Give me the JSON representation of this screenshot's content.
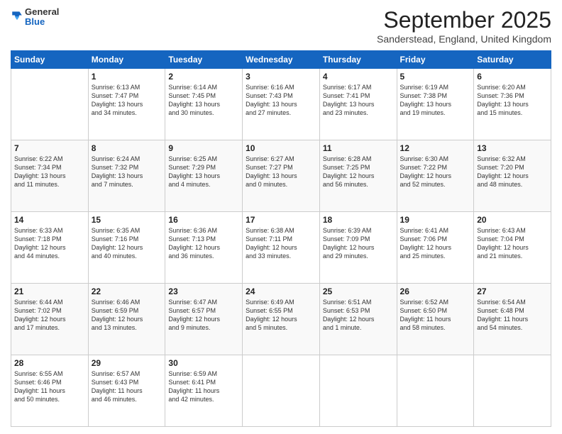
{
  "header": {
    "logo": {
      "general": "General",
      "blue": "Blue"
    },
    "title": "September 2025",
    "subtitle": "Sanderstead, England, United Kingdom"
  },
  "calendar": {
    "days": [
      "Sunday",
      "Monday",
      "Tuesday",
      "Wednesday",
      "Thursday",
      "Friday",
      "Saturday"
    ],
    "weeks": [
      [
        {
          "num": "",
          "info": ""
        },
        {
          "num": "1",
          "info": "Sunrise: 6:13 AM\nSunset: 7:47 PM\nDaylight: 13 hours\nand 34 minutes."
        },
        {
          "num": "2",
          "info": "Sunrise: 6:14 AM\nSunset: 7:45 PM\nDaylight: 13 hours\nand 30 minutes."
        },
        {
          "num": "3",
          "info": "Sunrise: 6:16 AM\nSunset: 7:43 PM\nDaylight: 13 hours\nand 27 minutes."
        },
        {
          "num": "4",
          "info": "Sunrise: 6:17 AM\nSunset: 7:41 PM\nDaylight: 13 hours\nand 23 minutes."
        },
        {
          "num": "5",
          "info": "Sunrise: 6:19 AM\nSunset: 7:38 PM\nDaylight: 13 hours\nand 19 minutes."
        },
        {
          "num": "6",
          "info": "Sunrise: 6:20 AM\nSunset: 7:36 PM\nDaylight: 13 hours\nand 15 minutes."
        }
      ],
      [
        {
          "num": "7",
          "info": "Sunrise: 6:22 AM\nSunset: 7:34 PM\nDaylight: 13 hours\nand 11 minutes."
        },
        {
          "num": "8",
          "info": "Sunrise: 6:24 AM\nSunset: 7:32 PM\nDaylight: 13 hours\nand 7 minutes."
        },
        {
          "num": "9",
          "info": "Sunrise: 6:25 AM\nSunset: 7:29 PM\nDaylight: 13 hours\nand 4 minutes."
        },
        {
          "num": "10",
          "info": "Sunrise: 6:27 AM\nSunset: 7:27 PM\nDaylight: 13 hours\nand 0 minutes."
        },
        {
          "num": "11",
          "info": "Sunrise: 6:28 AM\nSunset: 7:25 PM\nDaylight: 12 hours\nand 56 minutes."
        },
        {
          "num": "12",
          "info": "Sunrise: 6:30 AM\nSunset: 7:22 PM\nDaylight: 12 hours\nand 52 minutes."
        },
        {
          "num": "13",
          "info": "Sunrise: 6:32 AM\nSunset: 7:20 PM\nDaylight: 12 hours\nand 48 minutes."
        }
      ],
      [
        {
          "num": "14",
          "info": "Sunrise: 6:33 AM\nSunset: 7:18 PM\nDaylight: 12 hours\nand 44 minutes."
        },
        {
          "num": "15",
          "info": "Sunrise: 6:35 AM\nSunset: 7:16 PM\nDaylight: 12 hours\nand 40 minutes."
        },
        {
          "num": "16",
          "info": "Sunrise: 6:36 AM\nSunset: 7:13 PM\nDaylight: 12 hours\nand 36 minutes."
        },
        {
          "num": "17",
          "info": "Sunrise: 6:38 AM\nSunset: 7:11 PM\nDaylight: 12 hours\nand 33 minutes."
        },
        {
          "num": "18",
          "info": "Sunrise: 6:39 AM\nSunset: 7:09 PM\nDaylight: 12 hours\nand 29 minutes."
        },
        {
          "num": "19",
          "info": "Sunrise: 6:41 AM\nSunset: 7:06 PM\nDaylight: 12 hours\nand 25 minutes."
        },
        {
          "num": "20",
          "info": "Sunrise: 6:43 AM\nSunset: 7:04 PM\nDaylight: 12 hours\nand 21 minutes."
        }
      ],
      [
        {
          "num": "21",
          "info": "Sunrise: 6:44 AM\nSunset: 7:02 PM\nDaylight: 12 hours\nand 17 minutes."
        },
        {
          "num": "22",
          "info": "Sunrise: 6:46 AM\nSunset: 6:59 PM\nDaylight: 12 hours\nand 13 minutes."
        },
        {
          "num": "23",
          "info": "Sunrise: 6:47 AM\nSunset: 6:57 PM\nDaylight: 12 hours\nand 9 minutes."
        },
        {
          "num": "24",
          "info": "Sunrise: 6:49 AM\nSunset: 6:55 PM\nDaylight: 12 hours\nand 5 minutes."
        },
        {
          "num": "25",
          "info": "Sunrise: 6:51 AM\nSunset: 6:53 PM\nDaylight: 12 hours\nand 1 minute."
        },
        {
          "num": "26",
          "info": "Sunrise: 6:52 AM\nSunset: 6:50 PM\nDaylight: 11 hours\nand 58 minutes."
        },
        {
          "num": "27",
          "info": "Sunrise: 6:54 AM\nSunset: 6:48 PM\nDaylight: 11 hours\nand 54 minutes."
        }
      ],
      [
        {
          "num": "28",
          "info": "Sunrise: 6:55 AM\nSunset: 6:46 PM\nDaylight: 11 hours\nand 50 minutes."
        },
        {
          "num": "29",
          "info": "Sunrise: 6:57 AM\nSunset: 6:43 PM\nDaylight: 11 hours\nand 46 minutes."
        },
        {
          "num": "30",
          "info": "Sunrise: 6:59 AM\nSunset: 6:41 PM\nDaylight: 11 hours\nand 42 minutes."
        },
        {
          "num": "",
          "info": ""
        },
        {
          "num": "",
          "info": ""
        },
        {
          "num": "",
          "info": ""
        },
        {
          "num": "",
          "info": ""
        }
      ]
    ]
  }
}
